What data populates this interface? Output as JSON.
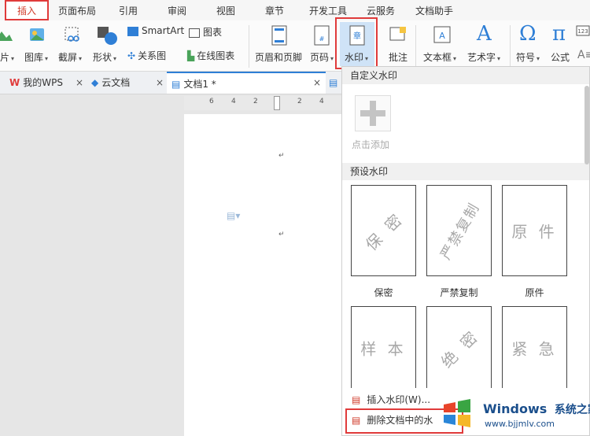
{
  "ribbon": {
    "tabs": [
      "插入",
      "页面布局",
      "引用",
      "审阅",
      "视图",
      "章节",
      "开发工具",
      "云服务",
      "文档助手"
    ],
    "buttons": {
      "picture_partial": "片",
      "gallery": "图库",
      "screenshot": "截屏",
      "shapes": "形状",
      "smartart": "SmartArt",
      "chart": "图表",
      "relation": "关系图",
      "online_chart": "在线图表",
      "header_footer": "页眉和页脚",
      "page_number": "页码",
      "watermark": "水印",
      "comment": "批注",
      "textbox": "文本框",
      "wordart": "艺术字",
      "symbol": "符号",
      "formula": "公式"
    }
  },
  "doc_tabs": {
    "wps": "我的WPS",
    "cloud": "云文档",
    "doc1": "文档1 *"
  },
  "ruler": {
    "numbers": [
      "6",
      "4",
      "2",
      "2",
      "4"
    ]
  },
  "watermark_menu": {
    "custom_header": "自定义水印",
    "add_label": "点击添加",
    "preset_header": "预设水印",
    "presets": [
      {
        "mark": "保 密",
        "label": "保密"
      },
      {
        "mark": "严禁复制",
        "label": "严禁复制"
      },
      {
        "mark": "原 件",
        "label": "原件"
      },
      {
        "mark": "样 本",
        "label": ""
      },
      {
        "mark": "绝 密",
        "label": ""
      },
      {
        "mark": "紧 急",
        "label": ""
      }
    ],
    "insert_item": "插入水印(W)...",
    "delete_item": "删除文档中的水"
  },
  "os_watermark": {
    "brand": "Windows",
    "cn": "系统之家",
    "url": "www.bjjmlv.com"
  },
  "colors": {
    "accent_red": "#e03b3b",
    "active_blue": "#cfe3f7"
  }
}
